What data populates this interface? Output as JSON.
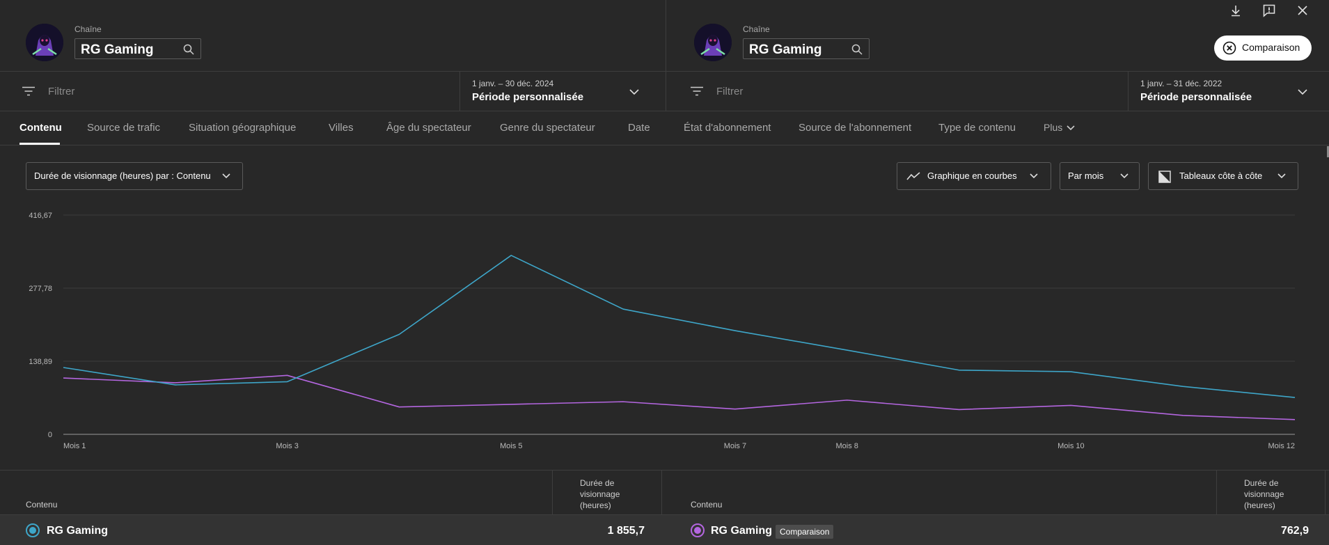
{
  "left_panel": {
    "channel_label": "Chaîne",
    "channel_name": "RG Gaming",
    "filter_placeholder": "Filtrer",
    "period_range": "1 janv. – 30 déc. 2024",
    "period_type": "Période personnalisée"
  },
  "right_panel": {
    "channel_label": "Chaîne",
    "channel_name": "RG Gaming",
    "filter_placeholder": "Filtrer",
    "period_range": "1 janv. – 31 déc. 2022",
    "period_type": "Période personnalisée"
  },
  "top_actions": {
    "compare_label": "Comparaison",
    "icons": [
      "download-icon",
      "feedback-icon",
      "close-icon"
    ]
  },
  "tabs": [
    {
      "label": "Contenu",
      "active": true
    },
    {
      "label": "Source de trafic"
    },
    {
      "label": "Situation géographique"
    },
    {
      "label": "Villes"
    },
    {
      "label": "Âge du spectateur"
    },
    {
      "label": "Genre du spectateur"
    },
    {
      "label": "Date"
    },
    {
      "label": "État d'abonnement"
    },
    {
      "label": "Source de l'abonnement"
    },
    {
      "label": "Type de contenu"
    },
    {
      "label": "Plus"
    }
  ],
  "controls": {
    "metric": "Durée de visionnage (heures) par : Contenu",
    "chart_type": "Graphique en courbes",
    "granularity": "Par mois",
    "layout": "Tableaux côte à côte"
  },
  "colors": {
    "series_primary": "#3ea6c9",
    "series_comparison": "#b466e0",
    "background": "#282828"
  },
  "chart_data": {
    "type": "line",
    "x_ticks": [
      "Mois 1",
      "Mois 3",
      "Mois 5",
      "Mois 7",
      "Mois 8",
      "Mois 10",
      "Mois 12"
    ],
    "y_ticks": [
      "0",
      "138,89",
      "277,78",
      "416,67"
    ],
    "ylim": [
      0,
      416.67
    ],
    "x": [
      1,
      2,
      3,
      4,
      5,
      6,
      7,
      8,
      9,
      10,
      11,
      12
    ],
    "series": [
      {
        "values": [
          127,
          94,
          100,
          190,
          340,
          238,
          197,
          160,
          122,
          119,
          91,
          70
        ]
      },
      {
        "values": [
          107,
          98,
          112,
          52,
          57,
          62,
          48,
          65,
          47,
          55,
          36,
          28
        ]
      }
    ],
    "grid": true
  },
  "table": {
    "col_content": "Contenu",
    "col_metric": "Durée de visionnage (heures)",
    "left_row": {
      "name": "RG Gaming",
      "value": "1 855,7"
    },
    "right_row": {
      "name": "RG Gaming",
      "badge": "Comparaison",
      "value": "762,9"
    }
  }
}
